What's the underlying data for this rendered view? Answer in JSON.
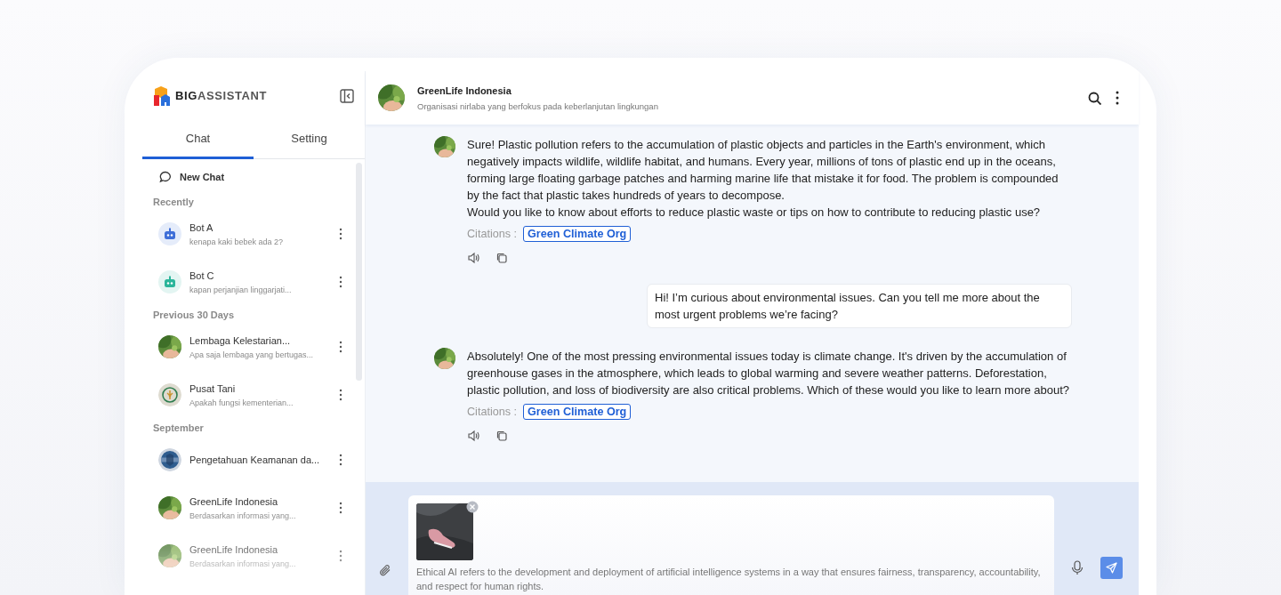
{
  "brand": {
    "logo_text_bold": "BIG",
    "logo_text": "ASSISTANT"
  },
  "sidebar": {
    "tabs": [
      {
        "label": "Chat",
        "selected": true
      },
      {
        "label": "Setting",
        "selected": false
      }
    ],
    "new_chat": "New Chat",
    "groups": [
      {
        "title": "Recently",
        "items": [
          {
            "title": "Bot A",
            "subtitle": "kenapa kaki bebek ada 2?",
            "kind": "bot",
            "color": "#3f6fd8"
          },
          {
            "title": "Bot C",
            "subtitle": "kapan perjanjian linggarjati...",
            "kind": "bot",
            "color": "#2bb59a"
          }
        ]
      },
      {
        "title": "Previous 30 Days",
        "items": [
          {
            "title": "Lembaga Kelestarian...",
            "subtitle": "Apa saja lembaga yang bertugas...",
            "kind": "picture"
          },
          {
            "title": "Pusat Tani",
            "subtitle": "Apakah fungsi kementerian...",
            "kind": "emblem"
          }
        ]
      },
      {
        "title": "September",
        "items": [
          {
            "title": "Pengetahuan Keamanan da...",
            "kind": "shield"
          },
          {
            "title": "GreenLife Indonesia",
            "subtitle": "Berdasarkan informasi yang...",
            "kind": "picture"
          },
          {
            "title": "GreenLife Indonesia",
            "subtitle": "Berdasarkan informasi yang...",
            "kind": "picture"
          }
        ]
      }
    ]
  },
  "header": {
    "title": "GreenLife Indonesia",
    "subtitle": "Organisasi nirlaba yang berfokus pada keberlanjutan lingkungan"
  },
  "messages": [
    {
      "kind": "bot",
      "paragraphs": [
        "Sure! Plastic pollution refers to the accumulation of plastic objects and particles in the Earth's environment, which negatively impacts wildlife, wildlife habitat, and humans. Every year, millions of tons of plastic end up in the oceans, forming large floating garbage patches and harming marine life that mistake it for food. The problem is compounded by the fact that plastic takes hundreds of years to decompose.",
        "Would you like to know about efforts to reduce plastic waste or tips on how to contribute to reducing plastic use?"
      ],
      "citations_label": "Citations :",
      "citations": [
        "Green Climate Org"
      ]
    },
    {
      "kind": "user",
      "paragraphs": [
        "Hi! I’m curious about environmental issues. Can you tell me more about the most urgent problems we’re facing?"
      ]
    },
    {
      "kind": "bot",
      "paragraphs": [
        "Absolutely! One of the most pressing environmental issues today is climate change. It's driven by the accumulation of greenhouse gases in the atmosphere, which leads to global warming and severe weather patterns. Deforestation, plastic pollution, and loss of biodiversity are also critical problems. Which of these would you like to learn more about?"
      ],
      "citations_label": "Citations :",
      "citations": [
        "Green Climate Org"
      ]
    }
  ],
  "composer": {
    "value": "Ethical AI refers to the development and deployment of artificial intelligence systems in a way that ensures fairness, transparency, accountability, and respect for human rights."
  }
}
